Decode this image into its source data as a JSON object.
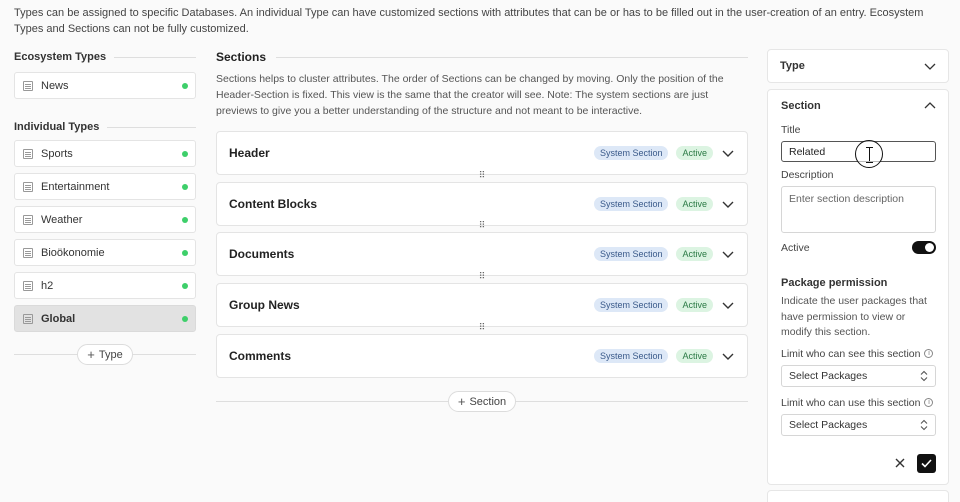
{
  "intro_text": "Types can be assigned to specific Databases. An individual Type can have customized sections with attributes that can be or has to be filled out in the user-creation of an entry. Ecosystem Types and Sections can not be fully customized.",
  "ecosystem_types": {
    "title": "Ecosystem Types",
    "items": [
      {
        "label": "News"
      }
    ]
  },
  "individual_types": {
    "title": "Individual Types",
    "items": [
      {
        "label": "Sports"
      },
      {
        "label": "Entertainment"
      },
      {
        "label": "Weather"
      },
      {
        "label": "Bioökonomie"
      },
      {
        "label": "h2"
      },
      {
        "label": "Global"
      }
    ],
    "add_label": "Type"
  },
  "status_color": "#3ecf6a",
  "sections": {
    "title": "Sections",
    "description": "Sections helps to cluster attributes. The order of Sections can be changed by moving. Only the position of the Header-Section is fixed. This view is the same that the creator will see. Note: The system sections are just previews to give you a better understanding of the structure and not meant to be interactive.",
    "items": [
      {
        "name": "Header",
        "system_badge": "System Section",
        "status_badge": "Active"
      },
      {
        "name": "Content Blocks",
        "system_badge": "System Section",
        "status_badge": "Active"
      },
      {
        "name": "Documents",
        "system_badge": "System Section",
        "status_badge": "Active"
      },
      {
        "name": "Group News",
        "system_badge": "System Section",
        "status_badge": "Active"
      },
      {
        "name": "Comments",
        "system_badge": "System Section",
        "status_badge": "Active"
      }
    ],
    "add_label": "Section"
  },
  "type_panel": {
    "title": "Type"
  },
  "section_panel": {
    "title": "Section",
    "title_label": "Title",
    "title_value": "Related",
    "description_label": "Description",
    "description_placeholder": "Enter section description",
    "active_label": "Active",
    "permission_title": "Package permission",
    "permission_desc": "Indicate the user packages that have permission to view or modify this section.",
    "see_label": "Limit who can see this section",
    "see_select": "Select Packages",
    "use_label": "Limit who can use this section",
    "use_select": "Select Packages"
  }
}
